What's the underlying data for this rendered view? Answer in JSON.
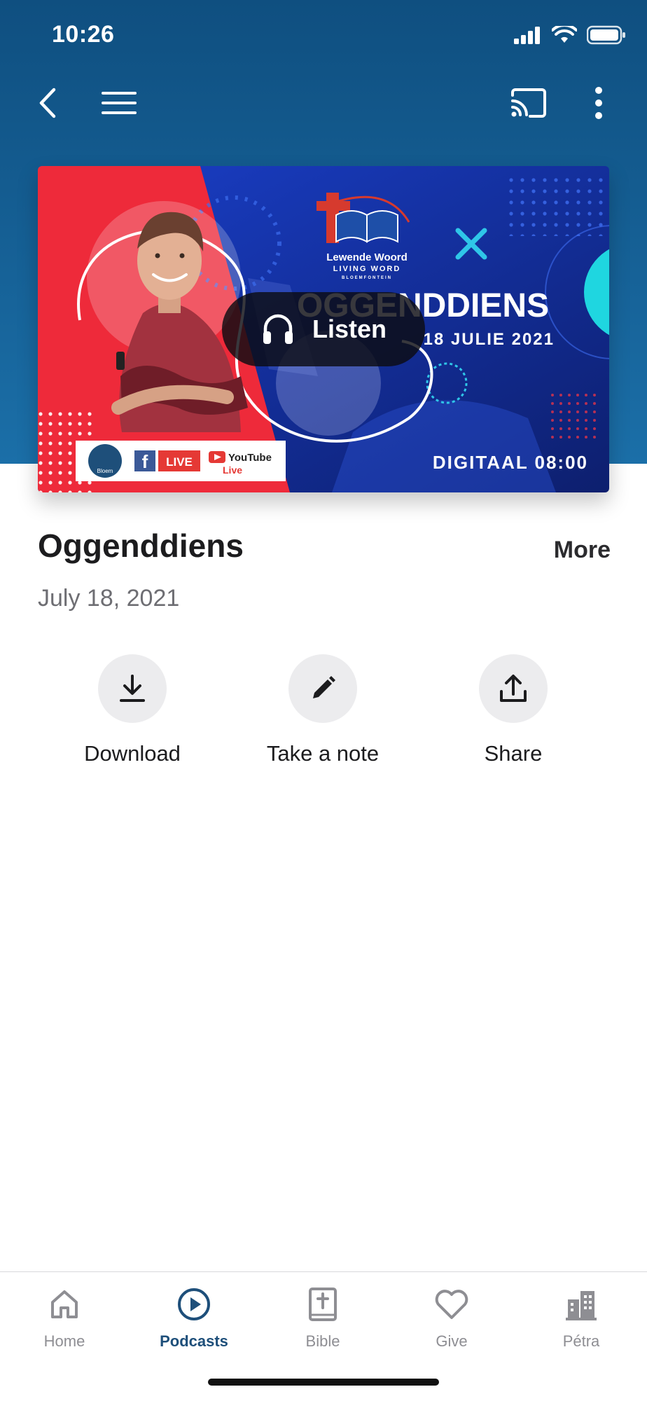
{
  "status_bar": {
    "time": "10:26"
  },
  "nav": {
    "back_icon": "chevron-left-icon",
    "menu_icon": "hamburger-icon",
    "cast_icon": "cast-icon",
    "more_icon": "more-vertical-icon"
  },
  "artwork": {
    "church_name": "Lewende Woord",
    "church_name_en": "LIVING WORD",
    "church_city": "BLOEMFONTEIN",
    "service_title": "OGGENDDIENS",
    "service_date": "18 JULIE 2021",
    "time_label": "DIGITAAL 08:00",
    "badge_bloem": "Bloem",
    "badge_live": "LIVE",
    "badge_youtube": "YouTube",
    "badge_youtube_live": "Live",
    "listen_label": "Listen"
  },
  "episode": {
    "title": "Oggenddiens",
    "more_label": "More",
    "date": "July 18, 2021"
  },
  "actions": [
    {
      "label": "Download",
      "icon": "download-icon"
    },
    {
      "label": "Take a note",
      "icon": "pencil-icon"
    },
    {
      "label": "Share",
      "icon": "share-icon"
    }
  ],
  "tabs": [
    {
      "label": "Home",
      "icon": "home-icon",
      "active": false
    },
    {
      "label": "Podcasts",
      "icon": "play-circle-icon",
      "active": true
    },
    {
      "label": "Bible",
      "icon": "bible-icon",
      "active": false
    },
    {
      "label": "Give",
      "icon": "heart-icon",
      "active": false
    },
    {
      "label": "Pétra",
      "icon": "building-icon",
      "active": false
    }
  ],
  "colors": {
    "header_blue": "#145b8f",
    "active_tab": "#1e4f7a",
    "inactive_tab": "#8e8e93",
    "art_red": "#ee2a3a",
    "art_blue": "#1235b8",
    "art_cyan": "#1fd6e0"
  }
}
